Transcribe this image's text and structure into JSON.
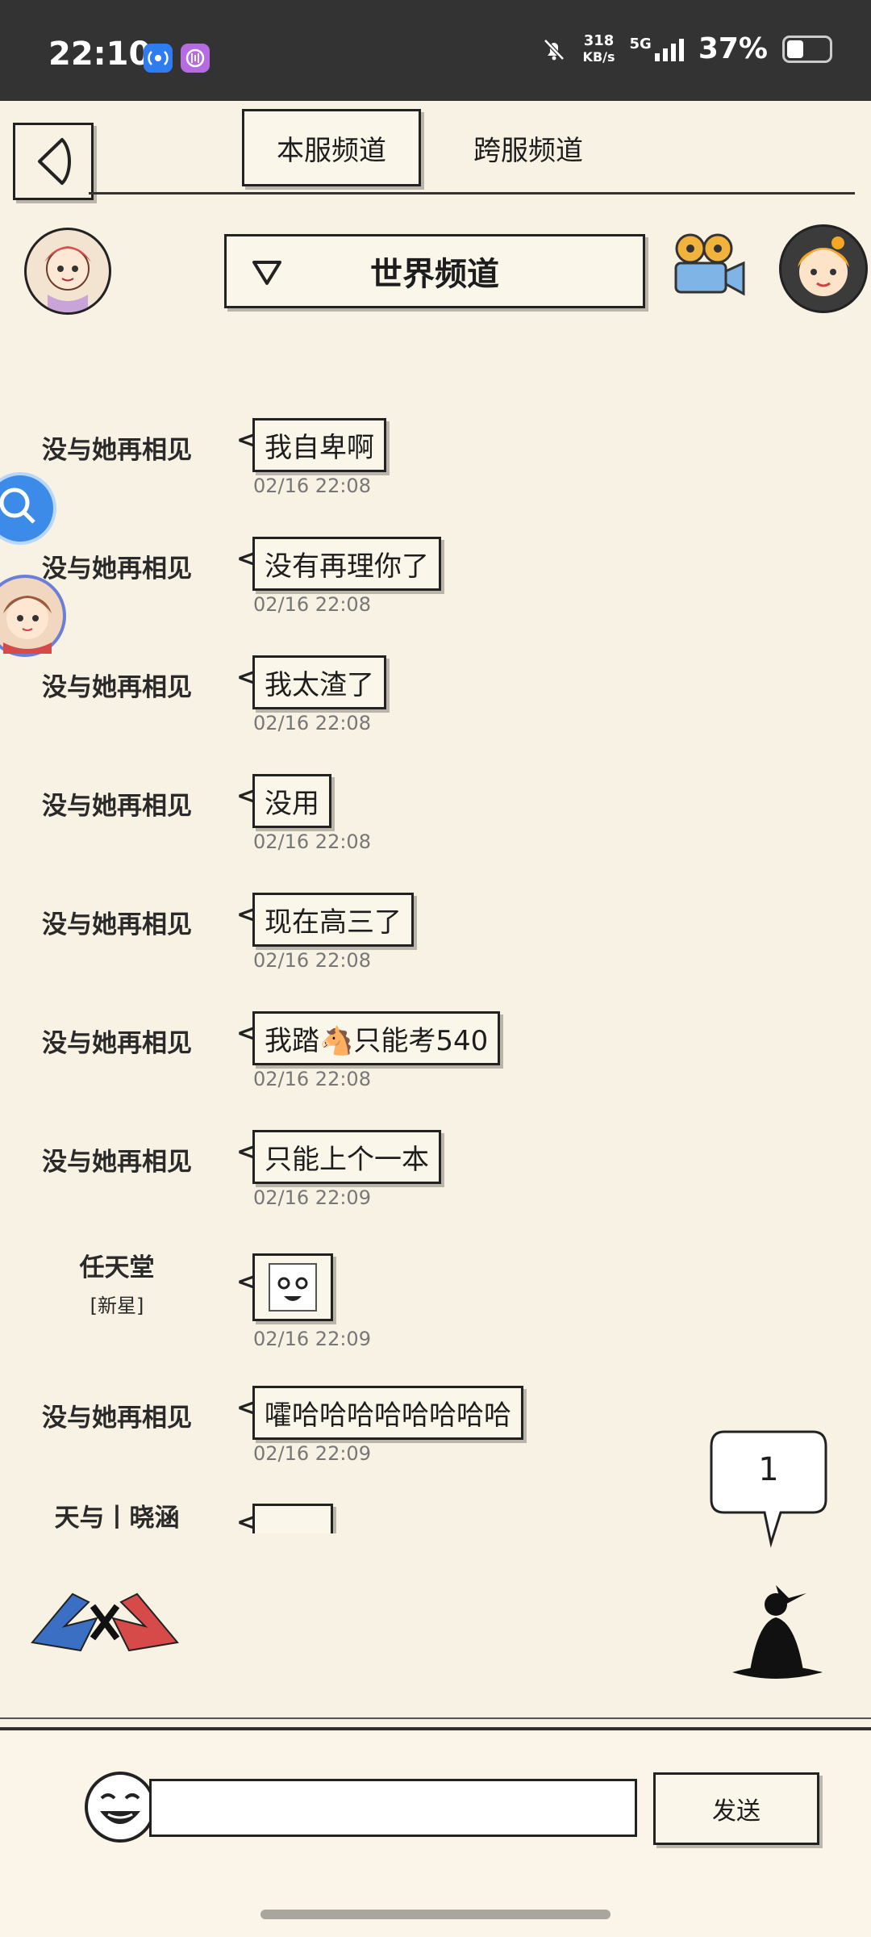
{
  "status_bar": {
    "time": "22:10",
    "speed_value": "318",
    "speed_unit": "KB/s",
    "network": "5G",
    "battery": "37%"
  },
  "header": {
    "tabs": [
      {
        "label": "本服频道",
        "active": true
      },
      {
        "label": "跨服频道",
        "active": false
      }
    ]
  },
  "channel": {
    "label": "世界频道"
  },
  "messages": [
    {
      "user": "没与她再相见",
      "text": "我自卑啊",
      "time": "02/16 22:08"
    },
    {
      "user": "没与她再相见",
      "text": "没有再理你了",
      "time": "02/16 22:08"
    },
    {
      "user": "没与她再相见",
      "text": "我太渣了",
      "time": "02/16 22:08"
    },
    {
      "user": "没与她再相见",
      "text": "没用",
      "time": "02/16 22:08"
    },
    {
      "user": "没与她再相见",
      "text": "现在高三了",
      "time": "02/16 22:08"
    },
    {
      "user": "没与她再相见",
      "text": "我踏🐴只能考540",
      "time": "02/16 22:08"
    },
    {
      "user": "没与她再相见",
      "text": "只能上个一本",
      "time": "02/16 22:09"
    },
    {
      "user": "任天堂",
      "tag": "[新星]",
      "sticker": "face-sticker",
      "time": "02/16 22:09"
    },
    {
      "user": "没与她再相见",
      "text": "嚯哈哈哈哈哈哈哈哈",
      "time": "02/16 22:09"
    },
    {
      "user": "天与丨晓涵",
      "sticker": "face-sticker"
    }
  ],
  "unread_bubble": {
    "count": "1"
  },
  "input": {
    "placeholder": "",
    "send_label": "发送"
  }
}
